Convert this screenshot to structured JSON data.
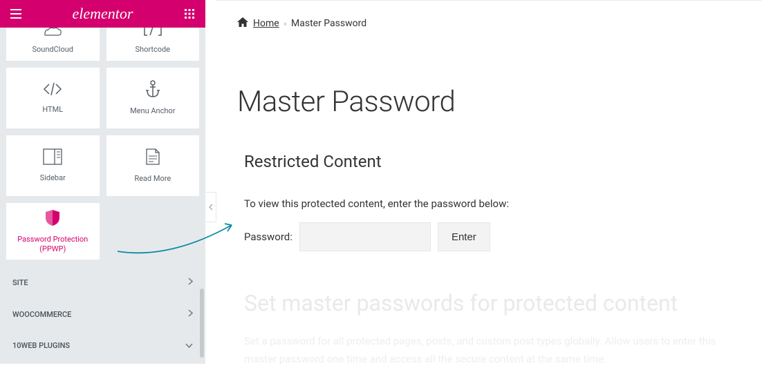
{
  "sidebar": {
    "brand": "elementor",
    "widgets": [
      {
        "id": "soundcloud",
        "label": "SoundCloud"
      },
      {
        "id": "shortcode",
        "label": "Shortcode"
      },
      {
        "id": "html",
        "label": "HTML"
      },
      {
        "id": "menu-anchor",
        "label": "Menu Anchor"
      },
      {
        "id": "sidebar",
        "label": "Sidebar"
      },
      {
        "id": "read-more",
        "label": "Read More"
      },
      {
        "id": "ppwp",
        "label": "Password Protection\n(PPWP)",
        "selected": true
      }
    ],
    "sections": [
      {
        "id": "site",
        "label": "SITE",
        "expanded": false
      },
      {
        "id": "woocommerce",
        "label": "WOOCOMMERCE",
        "expanded": false
      },
      {
        "id": "10web-plugins",
        "label": "10WEB PLUGINS",
        "expanded": true
      }
    ]
  },
  "preview": {
    "breadcrumb": {
      "home_label": "Home",
      "current": "Master Password"
    },
    "page_title": "Master Password",
    "restricted": {
      "heading": "Restricted Content",
      "description": "To view this protected content, enter the password below:",
      "password_label": "Password:",
      "enter_button": "Enter"
    },
    "watermark": {
      "title": "Set master passwords for protected content",
      "description": "Set a password for all protected pages, posts, and custom post types globally. Allow users to enter this master password one time and access all the secure content at the same time."
    }
  }
}
